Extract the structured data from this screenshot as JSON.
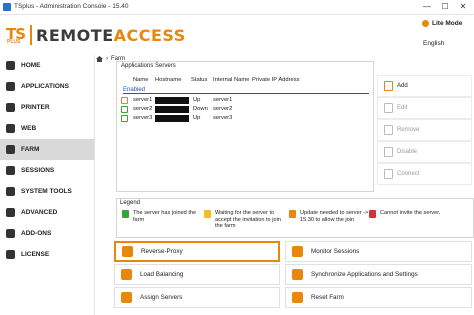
{
  "window": {
    "title": "TSplus - Administration Console - 15.40",
    "minimize": "—",
    "maximize": "☐",
    "close": "✕"
  },
  "header": {
    "logo": {
      "ts": "TS",
      "plus": "PLUS",
      "remote": "REMOTE",
      "access": "ACCESS"
    },
    "lite_mode": "Lite Mode",
    "language": "English"
  },
  "sidebar": {
    "items": [
      {
        "label": "HOME",
        "icon": "home-icon"
      },
      {
        "label": "APPLICATIONS",
        "icon": "applications-icon"
      },
      {
        "label": "PRINTER",
        "icon": "printer-icon"
      },
      {
        "label": "WEB",
        "icon": "web-icon"
      },
      {
        "label": "FARM",
        "icon": "farm-icon",
        "active": true
      },
      {
        "label": "SESSIONS",
        "icon": "sessions-icon"
      },
      {
        "label": "SYSTEM TOOLS",
        "icon": "system-tools-icon"
      },
      {
        "label": "ADVANCED",
        "icon": "advanced-icon"
      },
      {
        "label": "ADD-ONS",
        "icon": "add-ons-icon"
      },
      {
        "label": "LICENSE",
        "icon": "license-icon"
      }
    ]
  },
  "breadcrumb": {
    "current": "Farm"
  },
  "servers": {
    "caption": "Applications Servers",
    "columns": [
      "Name",
      "Hostname",
      "Status",
      "Internal Name",
      "Private IP Address"
    ],
    "group": "Enabled",
    "rows": [
      {
        "name": "server1",
        "status": "Up",
        "internal": "server1"
      },
      {
        "name": "server2",
        "status": "Down",
        "internal": "server2"
      },
      {
        "name": "server3",
        "status": "Up",
        "internal": "server3"
      }
    ]
  },
  "actions": {
    "add": "Add",
    "edit": "Edit",
    "remove": "Remove",
    "disable": "Disable",
    "connect": "Connect"
  },
  "legend": {
    "caption": "Legend",
    "items": [
      "The server has joined the farm",
      "Waiting for the server to accept the invitation to join the farm",
      "Update needed to server -> 15.30 to allow the join",
      "Cannot invite the server."
    ]
  },
  "buttons": {
    "reverse_proxy": "Reverse-Proxy",
    "monitor_sessions": "Monitor Sessions",
    "load_balancing": "Load Balancing",
    "synchronize": "Synchronize Applications and Settings",
    "assign_servers": "Assign Servers",
    "reset_farm": "Reset Farm"
  },
  "colors": {
    "accent": "#e8860e",
    "enabled_blue": "#1a56b5"
  }
}
